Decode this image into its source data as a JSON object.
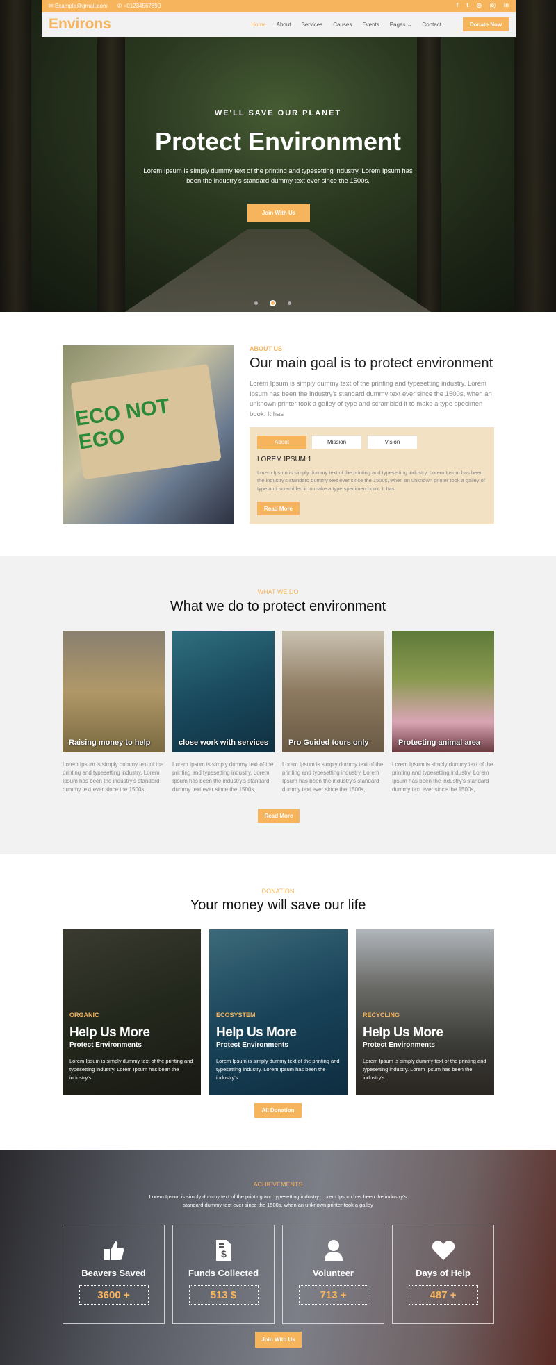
{
  "topbar": {
    "email": "Example@gmail.com",
    "phone": "+01234567890",
    "social": [
      "f",
      "t",
      "ig",
      "p",
      "in"
    ]
  },
  "nav": {
    "logo": "Environs",
    "items": [
      "Home",
      "About",
      "Services",
      "Causes",
      "Events",
      "Pages",
      "Contact"
    ],
    "active": "Home",
    "donate": "Donate Now"
  },
  "hero": {
    "eyebrow": "WE'LL SAVE OUR PLANET",
    "title": "Protect Environment",
    "text": "Lorem Ipsum is simply dummy text of the printing and typesetting industry. Lorem Ipsum has been the industry's standard dummy text ever since the 1500s,",
    "button": "Join With Us",
    "slide_count": 3,
    "active_slide": 2
  },
  "about": {
    "eyebrow": "ABOUT US",
    "title": "Our main goal is to protect environment",
    "text": "Lorem Ipsum is simply dummy text of the printing and typesetting industry. Lorem Ipsum has been the industry's standard dummy text ever since the 1500s, when an unknown printer took a galley of type and scrambled it to make a type specimen book. It has",
    "sign_text": "ECO NOT EGO",
    "tabs": [
      "About",
      "Mission",
      "Vision"
    ],
    "active_tab": "About",
    "tab_title": "LOREM IPSUM 1",
    "tab_text": "Lorem Ipsum is simply dummy text of the printing and typesetting industry. Lorem Ipsum has been the industry's standard dummy text ever since the 1500s, when an unknown printer took a galley of type and scrambled it to make a type specimen book. It has",
    "button": "Read More"
  },
  "whatwedo": {
    "eyebrow": "WHAT WE DO",
    "title": "What we do to protect environment",
    "cards": [
      {
        "caption": "Raising money to help",
        "text": "Lorem Ipsum is simply dummy text of the printing and typesetting industry. Lorem Ipsum has been the industry's standard dummy text ever since the 1500s,"
      },
      {
        "caption": "close work with services",
        "text": "Lorem Ipsum is simply dummy text of the printing and typesetting industry. Lorem Ipsum has been the industry's standard dummy text ever since the 1500s,"
      },
      {
        "caption": "Pro Guided tours only",
        "text": "Lorem Ipsum is simply dummy text of the printing and typesetting industry. Lorem Ipsum has been the industry's standard dummy text ever since the 1500s,"
      },
      {
        "caption": "Protecting animal area",
        "text": "Lorem Ipsum is simply dummy text of the printing and typesetting industry. Lorem Ipsum has been the industry's standard dummy text ever since the 1500s,"
      }
    ],
    "button": "Read More"
  },
  "donation": {
    "eyebrow": "DONATION",
    "title": "Your money will save our life",
    "cards": [
      {
        "tag": "ORGANIC",
        "title": "Help Us More",
        "subtitle": "Protect Environments",
        "text": "Lorem Ipsum is simply dummy text of the printing and typesetting industry. Lorem Ipsum has been the industry's"
      },
      {
        "tag": "ECOSYSTEM",
        "title": "Help Us More",
        "subtitle": "Protect Environments",
        "text": "Lorem Ipsum is simply dummy text of the printing and typesetting industry. Lorem Ipsum has been the industry's"
      },
      {
        "tag": "RECYCLING",
        "title": "Help Us More",
        "subtitle": "Protect Environments",
        "text": "Lorem Ipsum is simply dummy text of the printing and typesetting industry. Lorem Ipsum has been the industry's"
      }
    ],
    "button": "All Donation"
  },
  "achievements": {
    "eyebrow": "ACHIEVEMENTS",
    "text": "Lorem Ipsum is simply dummy text of the printing and typesetting industry. Lorem Ipsum has been the industry's standard dummy text ever since the 1500s, when an unknown printer took a galley",
    "items": [
      {
        "icon": "thumbs-up-icon",
        "label": "Beavers Saved",
        "value": "3600 +"
      },
      {
        "icon": "invoice-dollar-icon",
        "label": "Funds Collected",
        "value": "513 $"
      },
      {
        "icon": "user-icon",
        "label": "Volunteer",
        "value": "713 +"
      },
      {
        "icon": "heart-icon",
        "label": "Days of Help",
        "value": "487 +"
      }
    ],
    "button": "Join With Us"
  },
  "colors": {
    "accent": "#f6b45c",
    "tab_panel": "#f3e1c4",
    "section_grey": "#f2f2f2"
  }
}
